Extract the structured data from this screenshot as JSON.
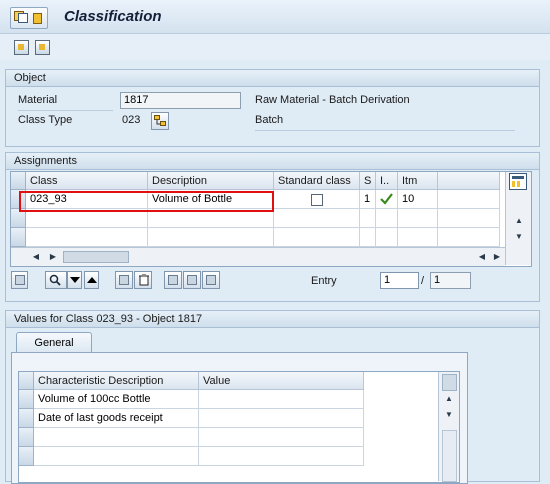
{
  "title": "Classification",
  "object": {
    "header": "Object",
    "material_label": "Material",
    "material_value": "1817",
    "material_description": "Raw Material - Batch Derivation",
    "class_type_label": "Class Type",
    "class_type_value": "023",
    "class_type_description": "Batch"
  },
  "assignments": {
    "header": "Assignments",
    "columns": [
      "Class",
      "Description",
      "Standard class",
      "S",
      "I..",
      "Itm"
    ],
    "rows": [
      {
        "class": "023_93",
        "description": "Volume of Bottle",
        "standard_class": false,
        "s": "1",
        "i": "checkmark-icon",
        "itm": "10"
      }
    ],
    "entry_label": "Entry",
    "entry_value": "1",
    "entry_separator": "/",
    "entry_total": "1"
  },
  "values": {
    "header": "Values for Class 023_93 - Object 1817",
    "tab_label": "General",
    "columns": [
      "Characteristic Description",
      "Value"
    ],
    "rows": [
      {
        "characteristic": "Volume of 100cc Bottle",
        "value": ""
      },
      {
        "characteristic": "Date of last goods receipt",
        "value": ""
      }
    ]
  },
  "colors": {
    "highlight": "#e01010",
    "check": "#3a8a1a"
  }
}
